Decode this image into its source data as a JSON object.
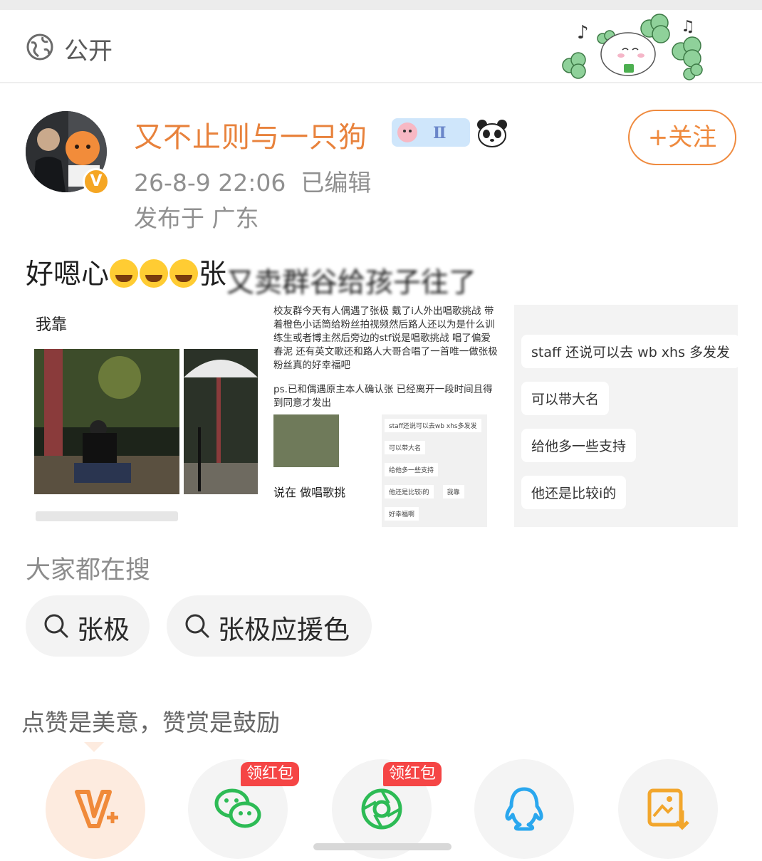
{
  "visibility": {
    "label": "公开",
    "icon": "globe-icon"
  },
  "post": {
    "author": "又不止则与一只狗",
    "time": "26-8-9 22:06",
    "edited": "已编辑",
    "location": "发布于 广东",
    "follow_label": "+关注",
    "text_prefix": "好嗯心",
    "text_suffix": "张",
    "text_blurred": "又卖群谷给孩子往了",
    "emojis": [
      "laugh-cry",
      "laugh-cry",
      "laugh-cry"
    ]
  },
  "images": {
    "img1_caption": "我靠",
    "img2_lines": "校友群今天有人偶遇了张极 戴了i人外出唱歌挑战 带着橙色小话筒给粉丝拍视频然后路人还以为是什么训练生或者博主然后旁边的stf说是唱歌挑战 唱了偏爱 春泥 还有英文歌还和路人大哥合唱了一首唯一做张极粉丝真的好幸福吧",
    "img2_ps": "ps.已和偶遇原主本人确认张 已经离开一段时间且得到同意才发出",
    "img2_sub": "说在 做唱歌挑",
    "img2_chat": [
      "staff还说可以去wb xhs多发发",
      "可以带大名",
      "给他多一些支持",
      "他还是比较i的",
      "我靠",
      "好幸福啊"
    ],
    "img3_bubbles": [
      "staff 还说可以去 wb xhs 多发发",
      "可以带大名",
      "给他多一些支持",
      "他还是比较i的"
    ]
  },
  "search": {
    "title": "大家都在搜",
    "chips": [
      "张极",
      "张极应援色"
    ]
  },
  "reward": {
    "title": "点赞是美意，赞赏是鼓励",
    "redpacket_label": "领红包",
    "share_targets": [
      "reward-v-icon",
      "wechat-icon",
      "moments-icon",
      "qq-icon",
      "save-image-icon"
    ]
  },
  "colors": {
    "accent": "#ef8a3e",
    "username": "#e8823c",
    "redpacket": "#f54545",
    "wechat": "#2dbb55",
    "qq": "#2aa7ee",
    "save": "#f2a62c"
  }
}
